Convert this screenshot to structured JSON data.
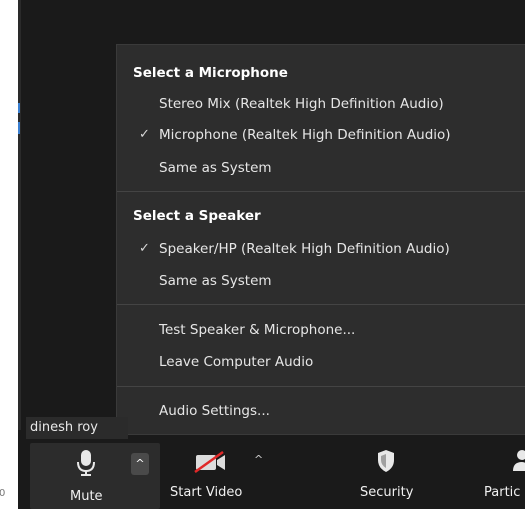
{
  "participant_name": "dinesh roy",
  "audio_menu": {
    "microphone_section": {
      "title": "Select a Microphone",
      "options": [
        {
          "label": "Stereo Mix (Realtek High Definition Audio)",
          "selected": false
        },
        {
          "label": "Microphone (Realtek High Definition Audio)",
          "selected": true
        },
        {
          "label": "Same as System",
          "selected": false
        }
      ]
    },
    "speaker_section": {
      "title": "Select a Speaker",
      "options": [
        {
          "label": "Speaker/HP (Realtek High Definition Audio)",
          "selected": true
        },
        {
          "label": "Same as System",
          "selected": false
        }
      ]
    },
    "actions": [
      "Test Speaker & Microphone...",
      "Leave Computer Audio"
    ],
    "settings": "Audio Settings...",
    "check_glyph": "✓"
  },
  "toolbar": {
    "mute_label": "Mute",
    "start_video_label": "Start Video",
    "security_label": "Security",
    "participants_label": "Partic",
    "caret_glyph": "^"
  },
  "edge_number": "0",
  "colors": {
    "background": "#1a1a1a",
    "menu_background": "#2d2d2d",
    "video_off_red": "#e02828"
  },
  "icons": [
    "microphone-icon",
    "video-off-icon",
    "shield-icon",
    "participants-icon",
    "check-icon",
    "caret-up-icon"
  ]
}
